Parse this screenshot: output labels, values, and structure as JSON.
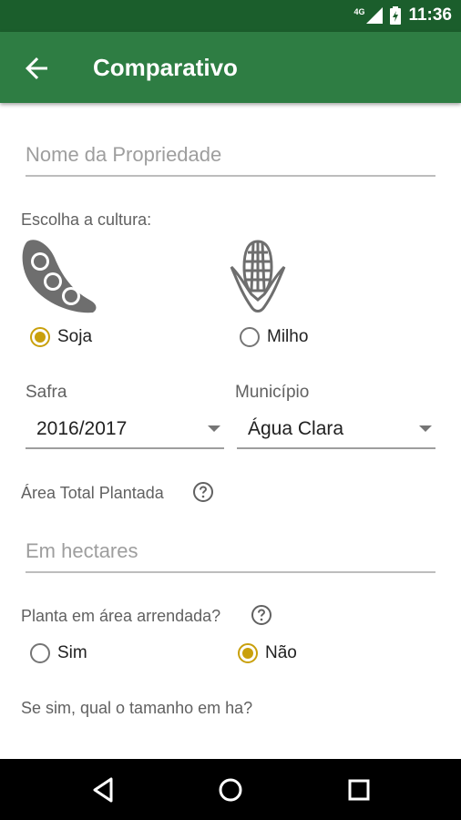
{
  "status_bar": {
    "network": "4G",
    "time": "11:36"
  },
  "app_bar": {
    "title": "Comparativo",
    "back_icon": "arrow-back-icon"
  },
  "form": {
    "property_name": {
      "placeholder": "Nome da Propriedade",
      "value": ""
    },
    "culture_label": "Escolha a cultura:",
    "cultures": [
      {
        "label": "Soja",
        "icon": "soybean-icon",
        "selected": true
      },
      {
        "label": "Milho",
        "icon": "corn-icon",
        "selected": false
      }
    ],
    "safra": {
      "label": "Safra",
      "value": "2016/2017"
    },
    "municipio": {
      "label": "Município",
      "value": "Água Clara"
    },
    "area_total": {
      "label": "Área Total Plantada",
      "placeholder": "Em hectares",
      "value": ""
    },
    "leased": {
      "label": "Planta em área arrendada?",
      "options": [
        {
          "label": "Sim",
          "selected": false
        },
        {
          "label": "Não",
          "selected": true
        }
      ]
    },
    "leased_size": {
      "label": "Se sim, qual o tamanho em ha?"
    }
  },
  "colors": {
    "status_bar": "#1b5e2c",
    "app_bar": "#2e7d43",
    "accent": "#c9a00c",
    "nav_bar": "#000000"
  }
}
